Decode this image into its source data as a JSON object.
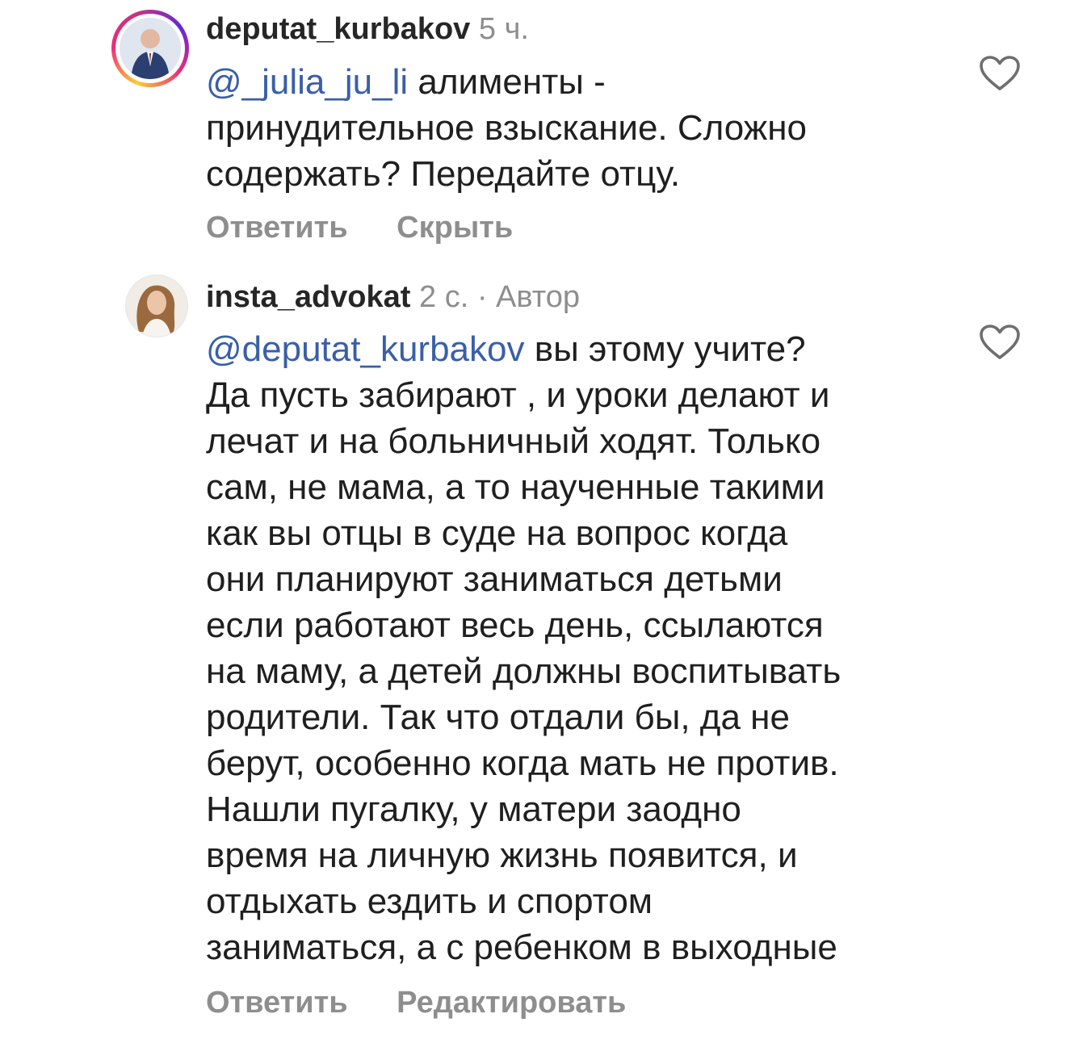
{
  "comments": [
    {
      "username": "deputat_kurbakov",
      "time": "5 ч.",
      "author_tag": "",
      "mention": "@_julia_ju_li",
      "lines": [
        " алименты -",
        "принудительное взыскание. Сложно",
        "содержать? Передайте отцу."
      ],
      "actions": [
        "Ответить",
        "Скрыть"
      ],
      "avatar_icon": "user-avatar-icon",
      "like_icon": "heart-outline-icon"
    },
    {
      "username": "insta_advokat",
      "time": "2 с.",
      "author_tag": "· Автор",
      "mention": "@deputat_kurbakov",
      "lines": [
        " вы этому учите?",
        "Да пусть забирают , и уроки делают и",
        "лечат и на больничный ходят. Только",
        "сам, не мама, а то наученные такими",
        "как вы отцы в суде на вопрос когда",
        "они планируют заниматься детьми",
        "если работают весь день, ссылаются",
        "на маму, а детей должны воспитывать",
        "родители. Так что отдали бы, да не",
        "берут, особенно когда мать не против.",
        "Нашли пугалку, у матери заодно",
        "время на личную жизнь появится, и",
        "отдыхать ездить и спортом",
        "заниматься, а с ребенком в выходные"
      ],
      "actions": [
        "Ответить",
        "Редактировать"
      ],
      "avatar_icon": "user-avatar-icon",
      "like_icon": "heart-outline-icon"
    }
  ],
  "colors": {
    "mention": "#3a5fa8",
    "meta": "#8e8e8e",
    "text": "#1f1f1f"
  }
}
